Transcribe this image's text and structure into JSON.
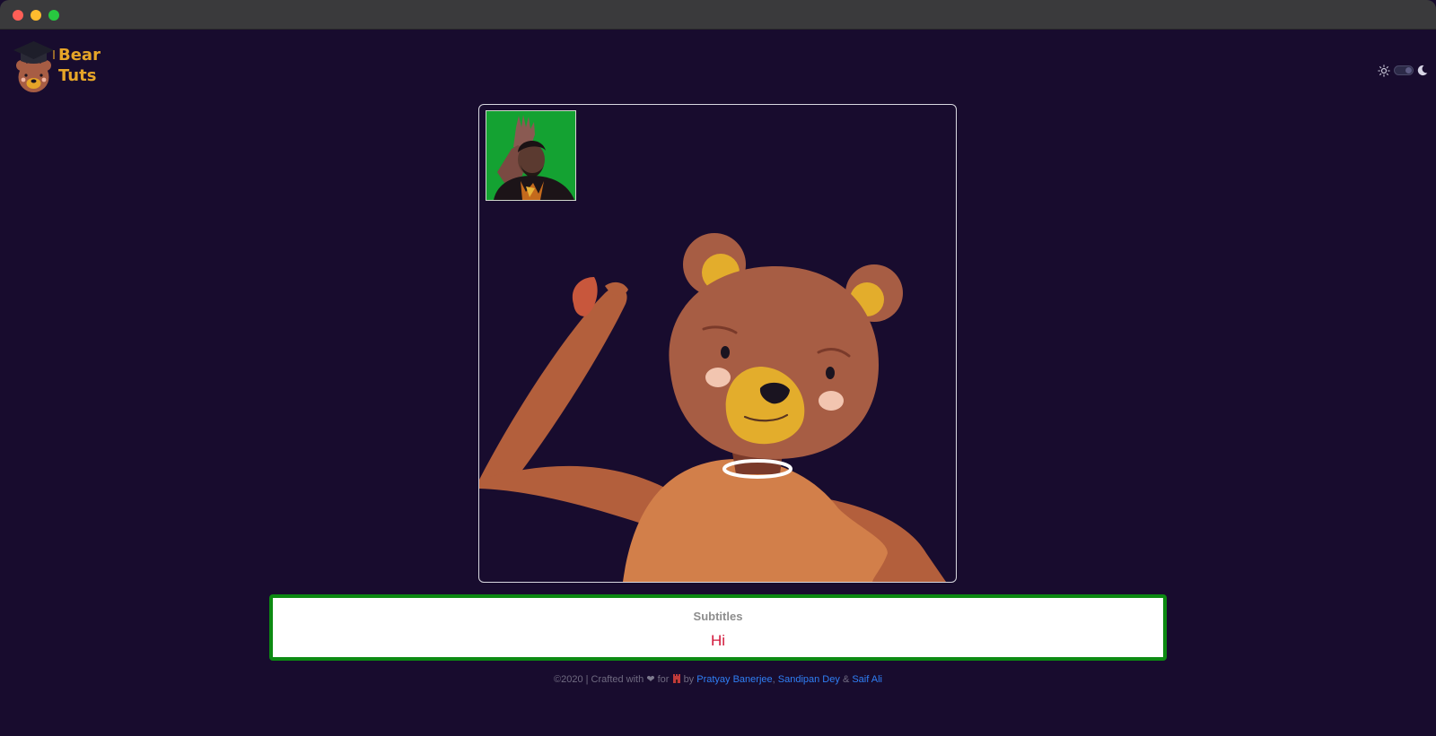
{
  "window": {
    "title": ""
  },
  "logo": {
    "line1": "Bear",
    "line2": "Tuts",
    "icon": "bear-graduate-icon"
  },
  "theme_toggle": {
    "light_icon": "sun-icon",
    "dark_icon": "moon-icon",
    "state": "dark"
  },
  "video": {
    "avatar": "bear-avatar",
    "webcam": "webcam-feed"
  },
  "subtitles": {
    "heading": "Subtitles",
    "text": "Hi"
  },
  "footer": {
    "prefix": "©2020 | Crafted with",
    "heart_icon": "❤",
    "for_text": "for",
    "by_text": "by",
    "author1": "Pratyay Banerjee",
    "comma": ",",
    "author2": "Sandipan Dey",
    "amp": "&",
    "author3": "Saif Ali"
  },
  "colors": {
    "background": "#180c2e",
    "logo": "#e6a528",
    "subtitle_border": "#0c8a12",
    "subtitle_text": "#d1173a",
    "link": "#2f7ff5"
  }
}
